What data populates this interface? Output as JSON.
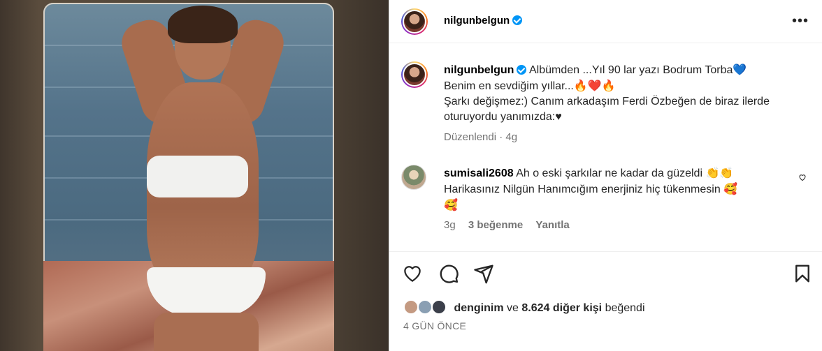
{
  "post": {
    "author": "nilgunbelgun",
    "more_label": "•••"
  },
  "caption": {
    "username": "nilgunbelgun",
    "line1": "Albümden ...Yıl 90 lar yazı Bodrum Torba",
    "line1_emoji": "💙",
    "line2": "Benim en sevdiğim yıllar...",
    "line2_emoji": "🔥❤️🔥",
    "line3": "Şarkı değişmez:) Canım arkadaşım Ferdi Özbeğen de biraz ilerde oturuyordu yanımızda:",
    "line3_emoji": "♥",
    "edited_label": "Düzenlendi",
    "separator": " · ",
    "age": "4g"
  },
  "comment": {
    "username": "sumisali2608",
    "text": "Ah o eski şarkılar ne kadar da güzeldi",
    "text_emoji": "👏👏",
    "text2": "Harikasınız Nilgün Hanımcığım enerjiniz hiç tükenmesin",
    "text2_emoji": "🥰",
    "text3_emoji": "🥰",
    "age": "3g",
    "likes": "3 beğenme",
    "reply": "Yanıtla"
  },
  "likes": {
    "first_user": "denginim",
    "connector": "ve",
    "others": "8.624 diğer kişi",
    "suffix": "beğendi"
  },
  "date_label": "4 GÜN ÖNCE",
  "icons": {
    "like": "heart-icon",
    "comment": "comment-icon",
    "share": "share-icon",
    "save": "bookmark-icon",
    "more": "more-icon",
    "verified": "verified-badge-icon"
  },
  "colors": {
    "verified": "#0095f6",
    "secondary_text": "#737373"
  }
}
